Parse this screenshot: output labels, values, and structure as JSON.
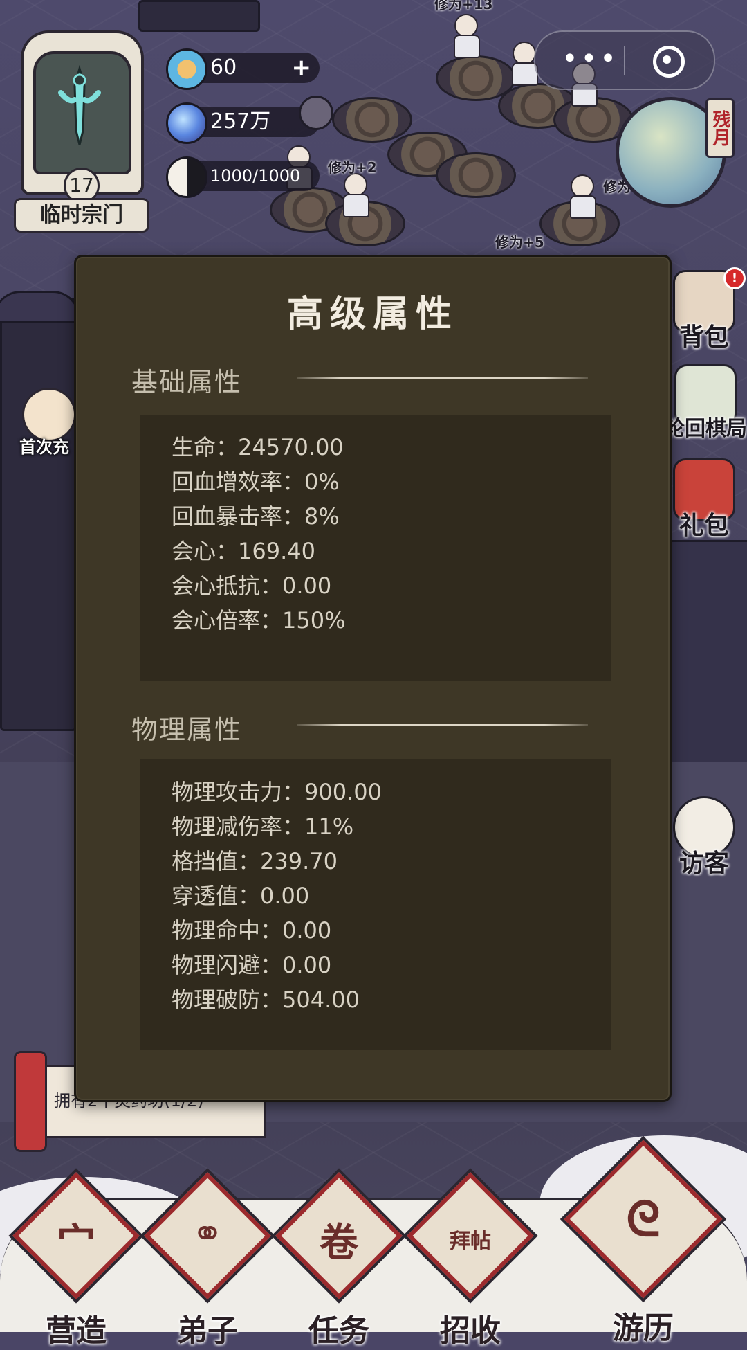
{
  "hud": {
    "sect_level": "17",
    "sect_name": "临时宗门",
    "resources": [
      {
        "icon": "spirit-stone-icon",
        "value": "60",
        "has_plus": true
      },
      {
        "icon": "crystal-icon",
        "value": "257万"
      },
      {
        "icon": "yin-yang-icon",
        "value": "1000/1000"
      }
    ],
    "moon_label": "残月"
  },
  "scene_floaters": [
    "修为+13",
    "修为+2",
    "修为+5",
    "修为+"
  ],
  "side_buttons": [
    {
      "label": "背包",
      "icon": "bag-icon",
      "badge": "!"
    },
    {
      "label": "轮回棋局",
      "icon": "go-board-icon"
    },
    {
      "label": "礼包",
      "icon": "gift-icon"
    },
    {
      "label": "访客",
      "icon": "visitor-icon"
    }
  ],
  "left_promo": {
    "label": "首次充"
  },
  "quest": {
    "text": "拥有2个灵药坊(1/2)"
  },
  "nav": [
    {
      "label": "营造",
      "glyph": "宀"
    },
    {
      "label": "弟子",
      "glyph": "⚭"
    },
    {
      "label": "任务",
      "glyph": "卷"
    },
    {
      "label": "招收",
      "glyph": "拜帖"
    },
    {
      "label": "游历",
      "glyph": "ᘓ"
    }
  ],
  "modal": {
    "title": "高级属性",
    "sections": [
      {
        "title": "基础属性",
        "stats": [
          "生命：24570.00",
          "回血增效率：0%",
          "回血暴击率：8%",
          "会心：169.40",
          "会心抵抗：0.00",
          "会心倍率：150%"
        ]
      },
      {
        "title": "物理属性",
        "stats": [
          "物理攻击力：900.00",
          "物理减伤率：11%",
          "格挡值：239.70",
          "穿透值：0.00",
          "物理命中：0.00",
          "物理闪避：0.00",
          "物理破防：504.00"
        ]
      }
    ]
  }
}
